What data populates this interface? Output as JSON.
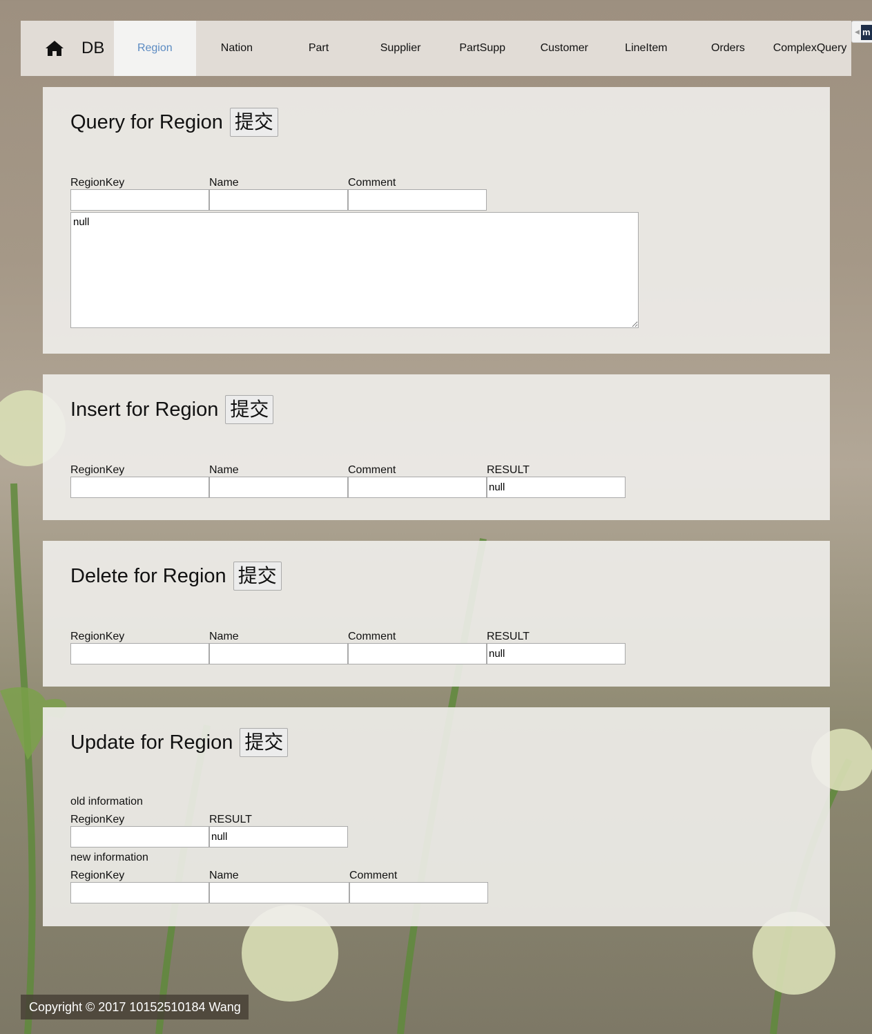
{
  "navbar": {
    "brand": "DB",
    "items": [
      "Region",
      "Nation",
      "Part",
      "Supplier",
      "PartSupp",
      "Customer",
      "LineItem",
      "Orders",
      "ComplexQuery"
    ],
    "active": "Region",
    "side_tab_text": "m"
  },
  "query": {
    "title": "Query for Region",
    "submit": "提交",
    "labels": [
      "RegionKey",
      "Name",
      "Comment"
    ],
    "result": "null"
  },
  "insert": {
    "title": "Insert for Region",
    "submit": "提交",
    "labels": [
      "RegionKey",
      "Name",
      "Comment",
      "RESULT"
    ],
    "result": "null"
  },
  "delete": {
    "title": "Delete for Region",
    "submit": "提交",
    "labels": [
      "RegionKey",
      "Name",
      "Comment",
      "RESULT"
    ],
    "result": "null"
  },
  "update": {
    "title": "Update for Region",
    "submit": "提交",
    "old_label": "old information",
    "old_labels": [
      "RegionKey",
      "RESULT"
    ],
    "result": "null",
    "new_label": "new information",
    "new_labels": [
      "RegionKey",
      "Name",
      "Comment"
    ]
  },
  "footer": "Copyright © 2017 10152510184 Wang"
}
